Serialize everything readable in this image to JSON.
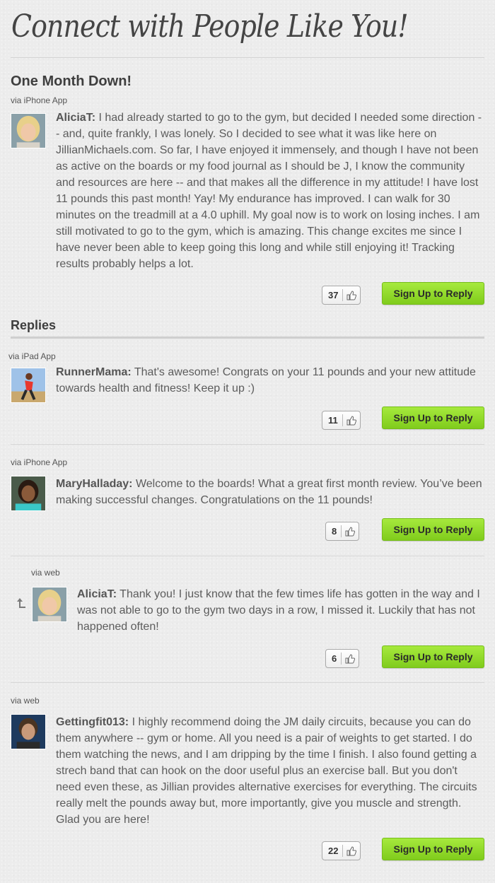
{
  "page": {
    "title": "Connect with People Like You!"
  },
  "post": {
    "title": "One Month Down!",
    "via": "via iPhone App",
    "author": "AliciaT:",
    "text": " I had already started to go to the gym, but decided I needed some direction -- and, quite frankly, I was lonely. So I decided to see what it was like here on JillianMichaels.com. So far, I have enjoyed it immensely, and though I have not been as active on the boards or my food journal as I should be J, I know the community and resources are here -- and that makes all the difference in my attitude! I have lost 11 pounds this past month! Yay! My endurance has improved. I can walk for 30 minutes on the treadmill at a 4.0 uphill. My goal now is to work on losing inches. I am still motivated to go to the gym, which is amazing. This change excites me since I have never been able to keep going this long and while still enjoying it! Tracking results probably helps a lot.",
    "likes": "37",
    "reply_label": "Sign Up to Reply"
  },
  "replies_heading": "Replies",
  "replies": [
    {
      "via": "via iPad App",
      "author": "RunnerMama:",
      "text": " That's awesome! Congrats on your 11 pounds and your new attitude towards health and fitness! Keep it up :)",
      "likes": "11",
      "reply_label": "Sign Up to Reply"
    },
    {
      "via": "via iPhone App",
      "author": "MaryHalladay:",
      "text": " Welcome to the boards! What a great first month review. You’ve been making successful changes. Congratulations on the 11 pounds!",
      "likes": "8",
      "reply_label": "Sign Up to Reply"
    },
    {
      "via": "via web",
      "author": "AliciaT:",
      "text": " Thank you! I just know that the few times life has gotten in the way and I was not able to go to the gym two days in a row, I missed it. Luckily that has not happened often!",
      "likes": "6",
      "reply_label": "Sign Up to Reply"
    },
    {
      "via": "via web",
      "author": "Gettingfit013:",
      "text": " I highly recommend doing the JM daily circuits, because you can do them anywhere -- gym or home. All you need is a pair of weights to get started. I do them watching the news, and I am dripping by the time I finish. I also found getting a strech band that can hook on the door useful plus an exercise ball. But you don't need even these, as Jillian provides alternative exercises for everything. The circuits really melt the pounds away but, more importantly, give you muscle and strength. Glad you are here!",
      "likes": "22",
      "reply_label": "Sign Up to Reply"
    }
  ],
  "colors": {
    "accent_green": "#8fdc2a",
    "text": "#5c5c5c",
    "heading": "#3e3e3e"
  },
  "icons": [
    "thumbs-up-icon",
    "nested-reply-arrow-icon"
  ]
}
